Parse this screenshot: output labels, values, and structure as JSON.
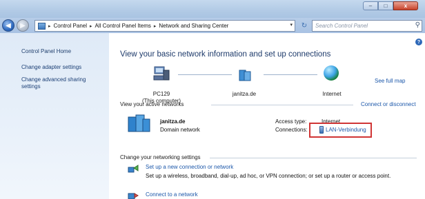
{
  "window": {
    "caption_buttons": [
      "–",
      "□",
      "x"
    ],
    "accent": "#1a56a9"
  },
  "navbar": {
    "back_icon": "back-arrow-icon",
    "forward_icon": "forward-arrow-icon",
    "breadcrumbs": [
      "Control Panel",
      "All Control Panel Items",
      "Network and Sharing Center"
    ],
    "search_placeholder": "Search Control Panel"
  },
  "sidebar": {
    "title": "Control Panel Home",
    "links": [
      "Change adapter settings",
      "Change advanced sharing settings"
    ]
  },
  "main": {
    "heading": "View your basic network information and set up connections",
    "see_full_map": "See full map",
    "map": {
      "nodes": [
        {
          "label": "PC129",
          "sublabel": "(This computer)",
          "icon": "computer-icon"
        },
        {
          "label": "janitza.de",
          "sublabel": "",
          "icon": "domain-network-icon"
        },
        {
          "label": "Internet",
          "sublabel": "",
          "icon": "globe-icon"
        }
      ]
    },
    "active_networks": {
      "label": "View your active networks",
      "connect_disconnect": "Connect or disconnect",
      "network_name": "janitza.de",
      "network_type": "Domain network",
      "access_type_label": "Access type:",
      "access_type_value": "Internet",
      "connections_label": "Connections:",
      "connection_name": "LAN-Verbindung"
    },
    "settings": {
      "label": "Change your networking settings",
      "tasks": [
        {
          "title": "Set up a new connection or network",
          "desc": "Set up a wireless, broadband, dial-up, ad hoc, or VPN connection; or set up a router or access point."
        },
        {
          "title": "Connect to a network",
          "desc": ""
        }
      ]
    },
    "highlight_color": "#d03434"
  }
}
